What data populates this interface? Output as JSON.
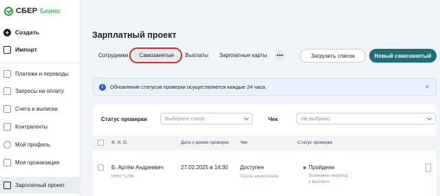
{
  "brand": {
    "name": "СБЕР",
    "sub": "Бизнес"
  },
  "sidebar": {
    "items": [
      {
        "label": "Создать"
      },
      {
        "label": "Импорт"
      },
      {
        "label": "Платежи и переводы"
      },
      {
        "label": "Запросы на оплату"
      },
      {
        "label": "Счета и выписки"
      },
      {
        "label": "Контрагенты"
      },
      {
        "label": "Мой профиль"
      },
      {
        "label": "Моя организация"
      },
      {
        "label": "Зарплатный проект"
      }
    ]
  },
  "page": {
    "title": "Зарплатный проект"
  },
  "tabs": [
    {
      "label": "Сотрудники"
    },
    {
      "label": "Самозанятые"
    },
    {
      "label": "Выплаты"
    },
    {
      "label": "Зарплатные карты"
    }
  ],
  "tabs_more": "•••",
  "actions": {
    "upload": "Загрузить список",
    "new": "Новый самозанятый"
  },
  "info": {
    "icon_glyph": "i",
    "text": "Обновление статусов проверки осуществляется каждые 24 часа.",
    "close_glyph": "×"
  },
  "filters": {
    "status_label": "Статус проверки",
    "status_placeholder": "Выберите статус",
    "check_label": "Чек",
    "check_value": "Не выбрано"
  },
  "table": {
    "headers": [
      "Ф. И. О.",
      "Дата и время проверки",
      "Чек",
      "Статус проверки"
    ],
    "rows": [
      {
        "name": "Б. Артём Андреевич",
        "inn": "ИНН *1256",
        "datetime": "27.02.2025 в 14:30",
        "check": "Доступен",
        "check_sub": "После зачисления",
        "status": "Пройдена",
        "status_sub_1": "Возможен переход",
        "status_sub_2": "к выплате"
      }
    ]
  },
  "colors": {
    "brand_green": "#21a038",
    "primary_button": "#1f6f7a",
    "highlight_ring": "#d42a2a",
    "info_bg": "#e8f1fc",
    "info_icon": "#2c5fb8"
  }
}
